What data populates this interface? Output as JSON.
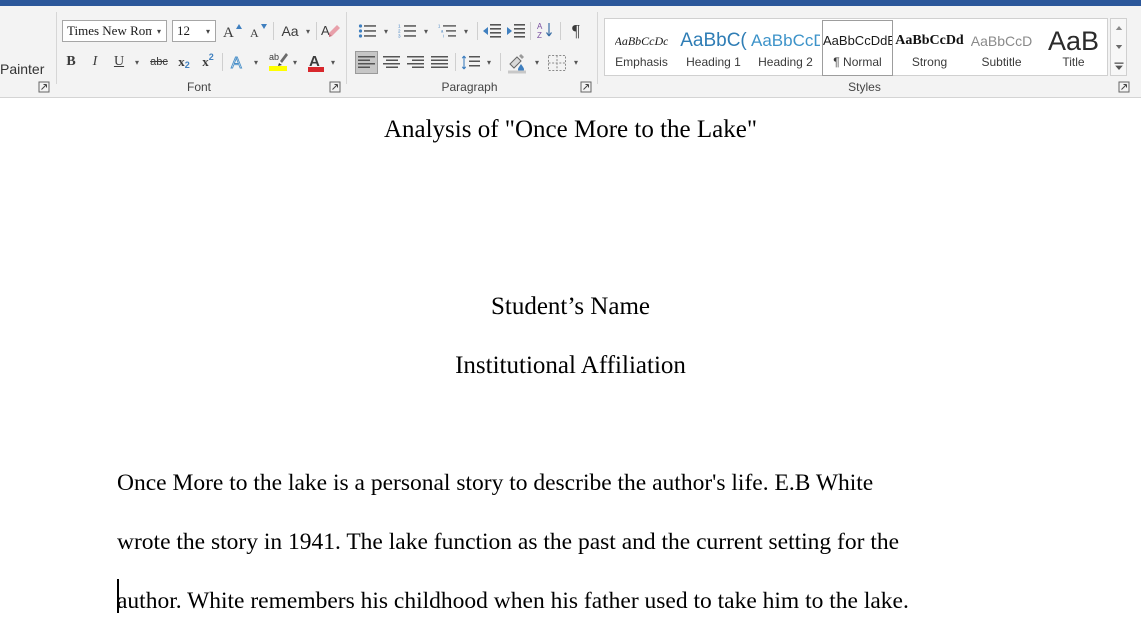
{
  "window": {
    "titlebar_color": "#2b579a"
  },
  "ribbon": {
    "clipboard": {
      "partial_label": "Painter",
      "launcher_name": "clipboard-dialog-launcher"
    },
    "font": {
      "group_label": "Font",
      "font_name": "Times New Roma",
      "font_size": "12",
      "grow_font": "A",
      "shrink_font": "A",
      "change_case": "Aa",
      "clear_formatting": "A",
      "bold": "B",
      "italic": "I",
      "underline": "U",
      "strikethrough": "abc",
      "subscript": "x",
      "subscript_sub": "2",
      "superscript": "x",
      "superscript_sup": "2",
      "text_effects": "A",
      "highlight": "ab",
      "font_color": "A"
    },
    "paragraph": {
      "group_label": "Paragraph",
      "bullets": "bullets",
      "numbering": "numbering",
      "multilevel": "multilevel-list",
      "decrease_indent": "decrease-indent",
      "increase_indent": "increase-indent",
      "sort": "sort",
      "show_marks": "¶",
      "align_left": "align-left",
      "align_center": "align-center",
      "align_right": "align-right",
      "justify": "justify",
      "line_spacing": "line-spacing",
      "shading": "shading",
      "borders": "borders",
      "active_alignment": "align-left"
    },
    "styles": {
      "group_label": "Styles",
      "selected": "Normal",
      "items": [
        {
          "preview": "AaBbCcDc",
          "label": "Emphasis",
          "class": "sp-emphasis"
        },
        {
          "preview": "AaBbC(",
          "label": "Heading 1",
          "class": "sp-h1"
        },
        {
          "preview": "AaBbCcD",
          "label": "Heading 2",
          "class": "sp-h2"
        },
        {
          "preview": "AaBbCcDdE",
          "label": "¶ Normal",
          "class": "sp-normal"
        },
        {
          "preview": "AaBbCcDd",
          "label": "Strong",
          "class": "sp-strong"
        },
        {
          "preview": "AaBbCcD",
          "label": "Subtitle",
          "class": "sp-subtitle"
        },
        {
          "preview": "AaB",
          "label": "Title",
          "class": "sp-title"
        }
      ],
      "scroll_up": "▲",
      "scroll_down": "▼",
      "more": "▾"
    }
  },
  "document": {
    "title": "Analysis of \"Once More to the Lake\"",
    "author_line": "Student’s Name",
    "affiliation_line": "Institutional Affiliation",
    "body_lines": [
      "Once More to the lake is a personal story to describe the author's life. E.B White",
      "wrote the story in 1941. The lake function as the past and the current setting for the",
      "author. White remembers his childhood when his father used to take him to the lake."
    ]
  }
}
